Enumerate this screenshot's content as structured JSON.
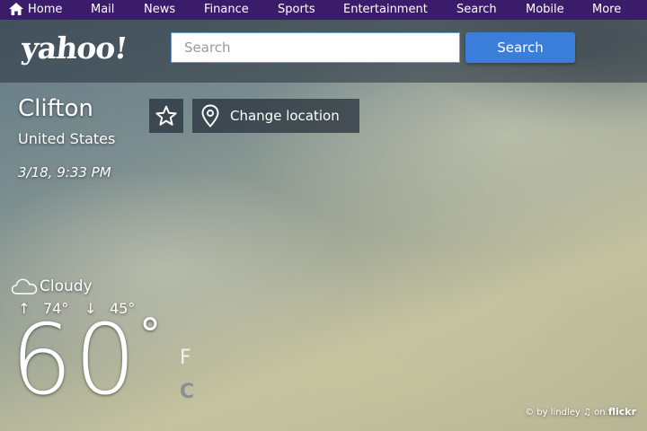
{
  "topnav": {
    "items": [
      "Home",
      "Mail",
      "News",
      "Finance",
      "Sports",
      "Entertainment",
      "Search",
      "Mobile",
      "More"
    ]
  },
  "header": {
    "logo": "yahoo!",
    "search_placeholder": "Search",
    "search_button": "Search"
  },
  "location": {
    "city": "Clifton",
    "country": "United States",
    "datetime": "3/18, 9:33 PM",
    "change_location_label": "Change location"
  },
  "weather": {
    "condition": "Cloudy",
    "high": "74°",
    "low": "45°",
    "temperature": "60",
    "degree_symbol": "°",
    "unit_f": "F",
    "unit_c": "C"
  },
  "credit": {
    "text": "© by lindley ♫ on",
    "site": "flickr"
  },
  "icons": {
    "home": "home-icon",
    "favorite": "star-icon",
    "location": "location-pin-icon",
    "condition": "cloud-icon",
    "high": "arrow-up-icon",
    "low": "arrow-down-icon"
  },
  "colors": {
    "nav_bg": "#3a1c6b",
    "search_button": "#3b7ddb",
    "search_border": "#6b9ad8"
  }
}
